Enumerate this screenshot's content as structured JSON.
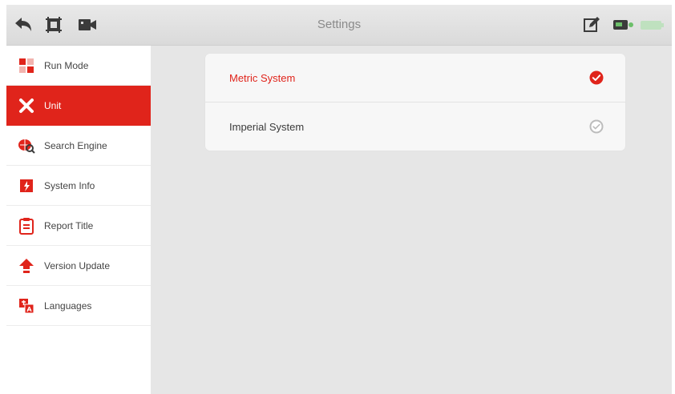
{
  "header": {
    "title": "Settings"
  },
  "sidebar": {
    "items": [
      {
        "label": "Run Mode",
        "icon": "run-mode-icon",
        "active": false
      },
      {
        "label": "Unit",
        "icon": "unit-icon",
        "active": true
      },
      {
        "label": "Search Engine",
        "icon": "search-engine-icon",
        "active": false
      },
      {
        "label": "System Info",
        "icon": "system-info-icon",
        "active": false
      },
      {
        "label": "Report Title",
        "icon": "report-title-icon",
        "active": false
      },
      {
        "label": "Version Update",
        "icon": "version-update-icon",
        "active": false
      },
      {
        "label": "Languages",
        "icon": "languages-icon",
        "active": false
      }
    ]
  },
  "units": {
    "options": [
      {
        "label": "Metric System",
        "selected": true
      },
      {
        "label": "Imperial System",
        "selected": false
      }
    ]
  },
  "colors": {
    "accent": "#e0241b",
    "background": "#e6e6e6",
    "header": "#dedede"
  }
}
